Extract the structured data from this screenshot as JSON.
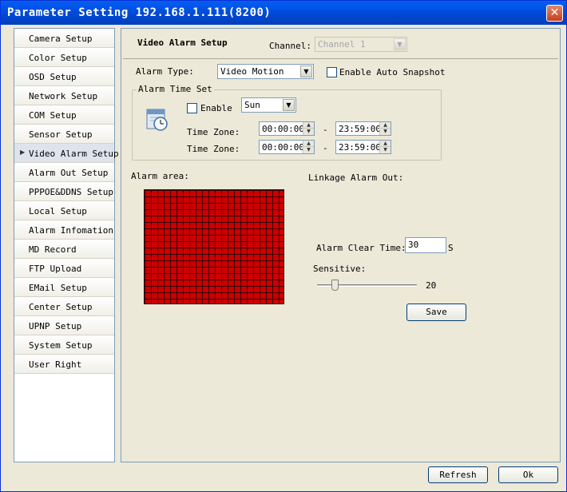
{
  "window": {
    "title": "Parameter Setting 192.168.1.111(8200)"
  },
  "sidebar": {
    "items": [
      {
        "label": "Camera Setup"
      },
      {
        "label": "Color Setup"
      },
      {
        "label": "OSD Setup"
      },
      {
        "label": "Network Setup"
      },
      {
        "label": "COM Setup"
      },
      {
        "label": "Sensor Setup"
      },
      {
        "label": "Video Alarm Setup",
        "active": true
      },
      {
        "label": "Alarm Out Setup"
      },
      {
        "label": "PPPOE&DDNS Setup"
      },
      {
        "label": "Local Setup"
      },
      {
        "label": "Alarm Infomation"
      },
      {
        "label": "MD Record"
      },
      {
        "label": "FTP Upload"
      },
      {
        "label": "EMail Setup"
      },
      {
        "label": "Center Setup"
      },
      {
        "label": "UPNP Setup"
      },
      {
        "label": "System Setup"
      },
      {
        "label": "User Right"
      }
    ]
  },
  "main": {
    "title": "Video Alarm Setup",
    "channel_label": "Channel:",
    "channel_value": "Channel 1",
    "alarm_type_label": "Alarm Type:",
    "alarm_type_value": "Video Motion",
    "auto_snapshot_label": "Enable Auto Snapshot",
    "auto_snapshot_checked": false,
    "alarm_time": {
      "group_title": "Alarm Time Set",
      "enable_label": "Enable",
      "enable_checked": false,
      "day_value": "Sun",
      "time_zone_label": "Time Zone:",
      "zones": [
        {
          "start": "00:00:00",
          "separator": "-",
          "end": "23:59:00"
        },
        {
          "start": "00:00:00",
          "separator": "-",
          "end": "23:59:00"
        }
      ]
    },
    "alarm_area_label": "Alarm area:",
    "linkage_label": "Linkage Alarm Out:",
    "clear_time_label": "Alarm Clear Time:",
    "clear_time_value": "30",
    "clear_time_unit": "S",
    "sensitive_label": "Sensitive:",
    "sensitive_value": "20",
    "save_label": "Save"
  },
  "footer": {
    "refresh_label": "Refresh",
    "ok_label": "Ok"
  },
  "colors": {
    "title_bar": "#0054e3",
    "alarm_grid": "#cc0000",
    "grid_lines": "#3a0000"
  }
}
